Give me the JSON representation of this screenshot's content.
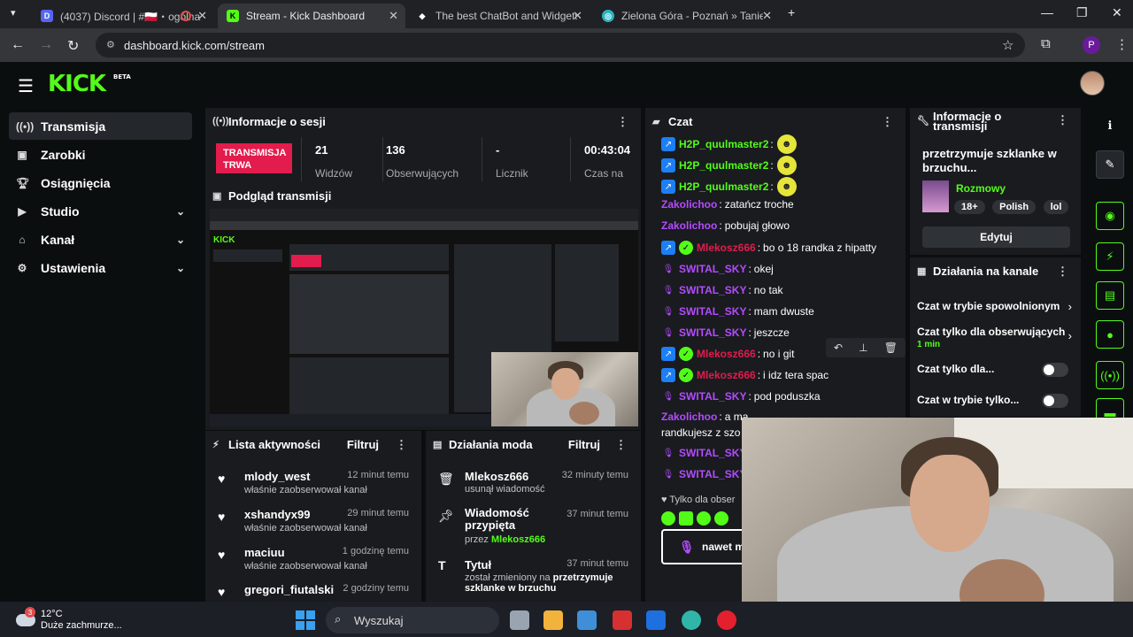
{
  "browser": {
    "tabs": [
      {
        "title": "(4037) Discord | #🇵🇱・ogólna",
        "favicon": "discord-icon"
      },
      {
        "title": "Stream - Kick Dashboard",
        "favicon": "kick-icon"
      },
      {
        "title": "The best ChatBot and Widgets",
        "favicon": "botrix-icon"
      },
      {
        "title": "Zielona Góra - Poznań » Tanie bilety",
        "favicon": "bus-icon"
      }
    ],
    "url": "dashboard.kick.com/stream",
    "profile_initial": "P"
  },
  "app": {
    "logo": "KICK",
    "logo_badge": "BETA",
    "accent": "#53fc18"
  },
  "sidebar": {
    "items": [
      {
        "label": "Transmisja",
        "icon": "broadcast-icon",
        "active": true
      },
      {
        "label": "Zarobki",
        "icon": "wallet-icon"
      },
      {
        "label": "Osiągnięcia",
        "icon": "trophy-icon"
      },
      {
        "label": "Studio",
        "icon": "camera-icon",
        "expandable": true
      },
      {
        "label": "Kanał",
        "icon": "channel-icon",
        "expandable": true
      },
      {
        "label": "Ustawienia",
        "icon": "gear-icon",
        "expandable": true
      }
    ]
  },
  "session": {
    "title": "Informacje o sesji",
    "status": "TRANSMISJA TRWA",
    "stats": [
      {
        "value": "21",
        "label": "Widzów"
      },
      {
        "value": "136",
        "label": "Obserwujących"
      },
      {
        "value": "-",
        "label": "Licznik"
      },
      {
        "value": "00:43:04",
        "label": "Czas na"
      }
    ]
  },
  "preview": {
    "title": "Podgląd transmisji"
  },
  "activity": {
    "title": "Lista aktywności",
    "filter": "Filtruj",
    "items": [
      {
        "name": "mlody_west",
        "desc": "właśnie zaobserwował kanał",
        "time": "12 minut temu"
      },
      {
        "name": "xshandyx99",
        "desc": "właśnie zaobserwował kanał",
        "time": "29 minut temu"
      },
      {
        "name": "maciuu",
        "desc": "właśnie zaobserwował kanał",
        "time": "1 godzinę temu"
      },
      {
        "name": "gregori_fiutalski",
        "desc": "",
        "time": "2 godziny temu"
      }
    ]
  },
  "modactions": {
    "title": "Działania moda",
    "filter": "Filtruj",
    "items": [
      {
        "title": "Mlekosz666",
        "desc": "usunął wiadomość",
        "time": "32 minuty temu",
        "icon": "trash-icon"
      },
      {
        "title": "Wiadomość przypięta",
        "desc_prefix": "przez",
        "desc_user": "Mlekosz666",
        "time": "37 minut temu",
        "icon": "pin-icon"
      },
      {
        "title": "Tytuł",
        "desc_prefix": "został zmieniony na",
        "desc_value": "przetrzymuje szklanke w brzuchu",
        "time": "37 minut temu",
        "icon": "text-icon"
      }
    ]
  },
  "chat": {
    "title": "Czat",
    "messages": [
      {
        "user": "H2P_quulmaster2",
        "text": "",
        "color": "#53fc18",
        "badge": "prime",
        "emote": true
      },
      {
        "user": "H2P_quulmaster2",
        "text": "",
        "color": "#53fc18",
        "badge": "prime",
        "emote": true
      },
      {
        "user": "H2P_quulmaster2",
        "text": "",
        "color": "#53fc18",
        "badge": "prime",
        "emote": true
      },
      {
        "user": "Zakolichoo",
        "text": "zatańcz troche",
        "color": "#b44bff"
      },
      {
        "user": "Zakolichoo",
        "text": "pobujaj głowo",
        "color": "#b44bff"
      },
      {
        "user": "Mlekosz666",
        "text": "bo o 18 randka z hipatty",
        "color": "#e21c4c",
        "badge": "prime",
        "mod": true
      },
      {
        "user": "SWITAL_SKY",
        "text": "okej",
        "color": "#b44bff",
        "badge": "mic"
      },
      {
        "user": "SWITAL_SKY",
        "text": "no tak",
        "color": "#b44bff",
        "badge": "mic"
      },
      {
        "user": "SWITAL_SKY",
        "text": "mam dwuste",
        "color": "#b44bff",
        "badge": "mic"
      },
      {
        "user": "SWITAL_SKY",
        "text": "jeszcze",
        "color": "#b44bff",
        "badge": "mic"
      },
      {
        "user": "Mlekosz666",
        "text": "no i git",
        "color": "#e21c4c",
        "badge": "prime",
        "mod": true
      },
      {
        "user": "Mlekosz666",
        "text": "i idz tera spac",
        "color": "#e21c4c",
        "badge": "prime",
        "mod": true
      },
      {
        "user": "SWITAL_SKY",
        "text": "pod poduszka",
        "color": "#b44bff",
        "badge": "mic"
      },
      {
        "user": "Zakolichoo",
        "text": "a ma",
        "color": "#b44bff"
      },
      {
        "user": "",
        "text": "randkujesz z szo",
        "color": "#fff"
      },
      {
        "user": "SWITAL_SKY",
        "text": "",
        "color": "#b44bff",
        "badge": "mic"
      },
      {
        "user": "SWITAL_SKY",
        "text": "",
        "color": "#b44bff",
        "badge": "mic"
      }
    ],
    "followers_only": "Tylko dla obser",
    "input_value": "nawet m"
  },
  "streaminfo": {
    "title": "Informacje o transmisji",
    "stream_title": "przetrzymuje szklanke w brzuchu...",
    "category": "Rozmowy",
    "tags": [
      "18+",
      "Polish",
      "lol"
    ],
    "edit": "Edytuj"
  },
  "channelactions": {
    "title": "Działania na kanale",
    "items": [
      {
        "label": "Czat w trybie spowolnionym",
        "type": "arrow"
      },
      {
        "label": "Czat tylko dla obserwujących",
        "sub": "1 min",
        "type": "arrow"
      },
      {
        "label": "Czat tylko dla...",
        "type": "toggle"
      },
      {
        "label": "Czat w trybie tylko...",
        "type": "toggle"
      }
    ]
  },
  "taskbar": {
    "temp": "12°C",
    "weather": "Duże zachmurze...",
    "weather_badge": "3",
    "search": "Wyszukaj"
  }
}
